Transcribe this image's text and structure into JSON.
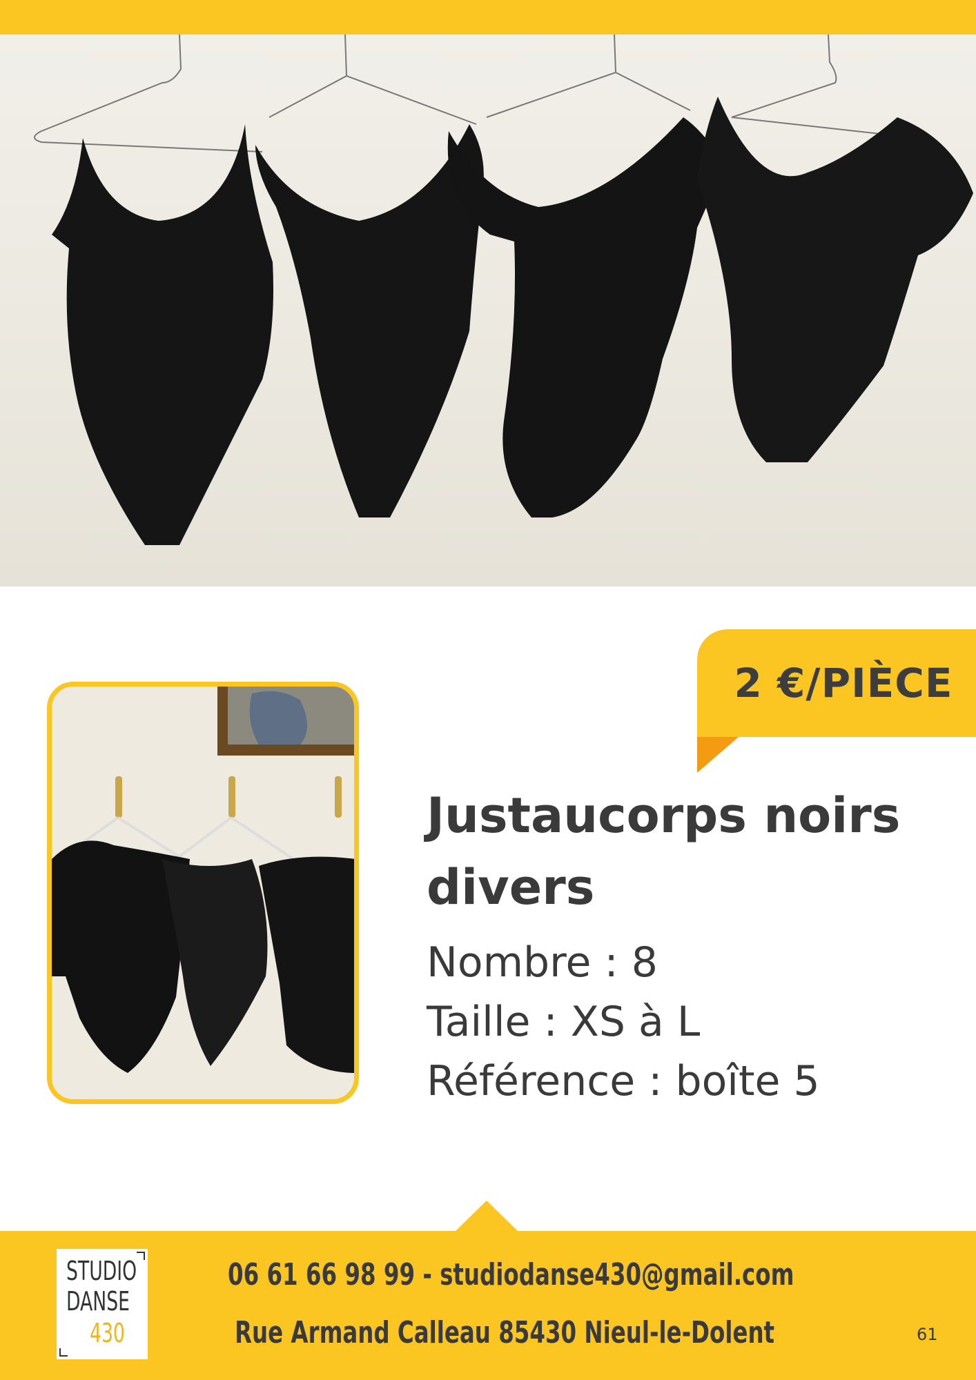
{
  "price": "2 €/PIÈCE",
  "title_line1": "Justaucorps noirs",
  "title_line2": "divers",
  "details": {
    "nombre": "Nombre : 8",
    "taille": "Taille : XS à L",
    "reference": "Référence : boîte 5"
  },
  "logo": {
    "line1": "STUDIO",
    "line2": "DANSE",
    "line3": "430"
  },
  "footer": {
    "contact": "06 61 66 98 99 - studiodanse430@gmail.com",
    "address": "Rue Armand Calleau 85430 Nieul-le-Dolent"
  },
  "page_number": "61",
  "colors": {
    "accent": "#fbc522",
    "accent_dark": "#f39c12",
    "text": "#3a3a3a"
  }
}
